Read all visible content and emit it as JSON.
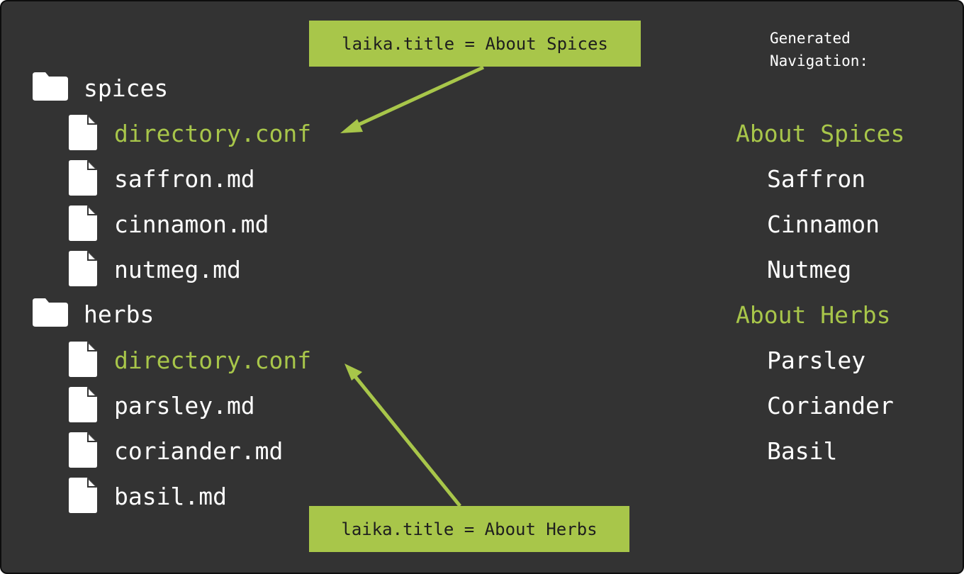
{
  "colors": {
    "background": "#333333",
    "accent": "#a8c64a",
    "text": "#ffffff"
  },
  "tree": {
    "folders": [
      {
        "name": "spices",
        "icon": "folder-icon",
        "files": [
          {
            "name": "directory.conf",
            "icon": "file-icon",
            "highlight": true
          },
          {
            "name": "saffron.md",
            "icon": "file-icon"
          },
          {
            "name": "cinnamon.md",
            "icon": "file-icon"
          },
          {
            "name": "nutmeg.md",
            "icon": "file-icon"
          }
        ]
      },
      {
        "name": "herbs",
        "icon": "folder-icon",
        "files": [
          {
            "name": "directory.conf",
            "icon": "file-icon",
            "highlight": true
          },
          {
            "name": "parsley.md",
            "icon": "file-icon"
          },
          {
            "name": "coriander.md",
            "icon": "file-icon"
          },
          {
            "name": "basil.md",
            "icon": "file-icon"
          }
        ]
      }
    ]
  },
  "callouts": {
    "spices": "laika.title = About Spices",
    "herbs": "laika.title = About Herbs"
  },
  "navigation": {
    "caption": "Generated\nNavigation:",
    "sections": [
      {
        "title": "About Spices",
        "items": [
          "Saffron",
          "Cinnamon",
          "Nutmeg"
        ]
      },
      {
        "title": "About Herbs",
        "items": [
          "Parsley",
          "Coriander",
          "Basil"
        ]
      }
    ]
  }
}
